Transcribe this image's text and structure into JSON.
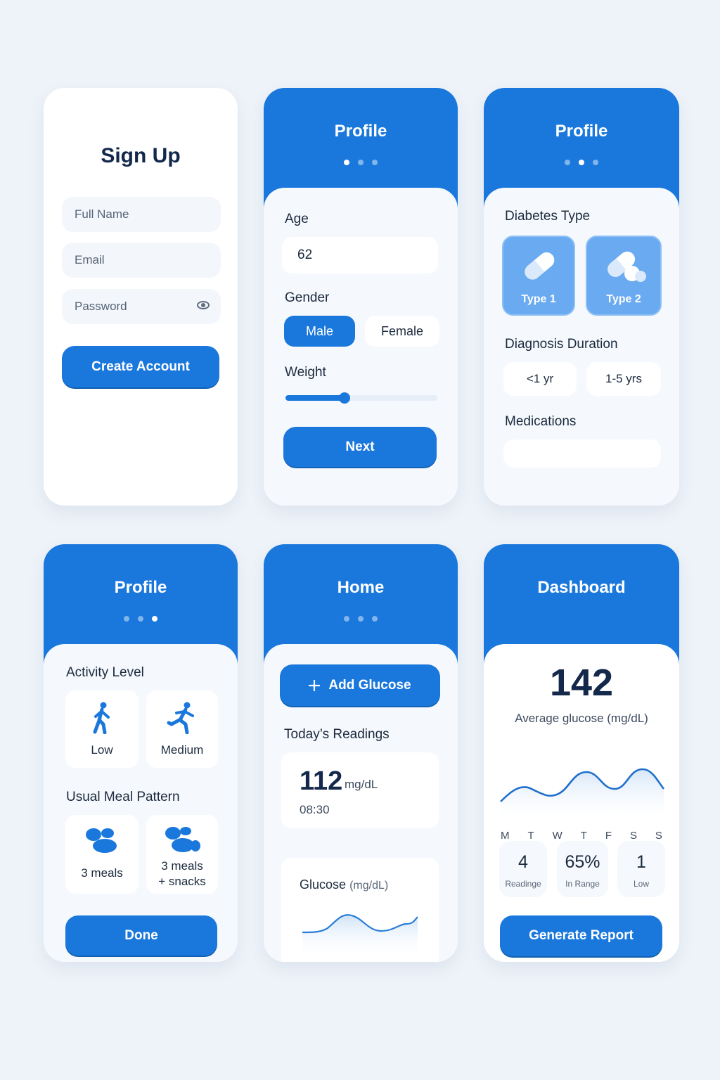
{
  "signup": {
    "title": "Sign Up",
    "full_name_placeholder": "Full Name",
    "email_placeholder": "Email",
    "password_placeholder": "Password",
    "create_label": "Create Account"
  },
  "profile1": {
    "title": "Profile",
    "age_label": "Age",
    "age_value": "62",
    "gender_label": "Gender",
    "gender_options": [
      "Male",
      "Female"
    ],
    "gender_selected": "Male",
    "weight_label": "Weight",
    "weight_slider_fraction": 0.39,
    "next_label": "Next",
    "step": 1
  },
  "profile2": {
    "title": "Profile",
    "diabetes_label": "Diabetes Type",
    "types": [
      "Type 1",
      "Type 2"
    ],
    "duration_label": "Diagnosis Duration",
    "durations": [
      "<1 yr",
      "1-5 yrs"
    ],
    "medications_label": "Medications",
    "step": 2
  },
  "profile3": {
    "title": "Profile",
    "activity_label": "Activity Level",
    "activity_options": [
      "Low",
      "Medium"
    ],
    "meal_label": "Usual Meal Pattern",
    "meal_options": [
      "3 meals",
      "3 meals",
      "+ snacks"
    ],
    "done_label": "Done",
    "step": 3
  },
  "home": {
    "title": "Home",
    "add_label": "Add Glucose",
    "readings_label": "Today’s Readings",
    "reading_value": "112",
    "reading_unit": "mg/dL",
    "reading_time": "08:30",
    "glucose_title": "Glucose",
    "glucose_unit": "(mg/dL)"
  },
  "dashboard": {
    "title": "Dashboard",
    "average_value": "142",
    "average_label": "Average glucose (mg/dL)",
    "days": [
      "M",
      "T",
      "W",
      "T",
      "F",
      "S",
      "S"
    ],
    "stats": [
      {
        "value": "4",
        "label": "Readinge"
      },
      {
        "value": "65%",
        "label": "In Range"
      },
      {
        "value": "1",
        "label": "Low"
      }
    ],
    "report_label": "Generate Report"
  },
  "colors": {
    "primary": "#1a78dc",
    "background": "#eef3f9",
    "card": "#f5f8fc"
  }
}
